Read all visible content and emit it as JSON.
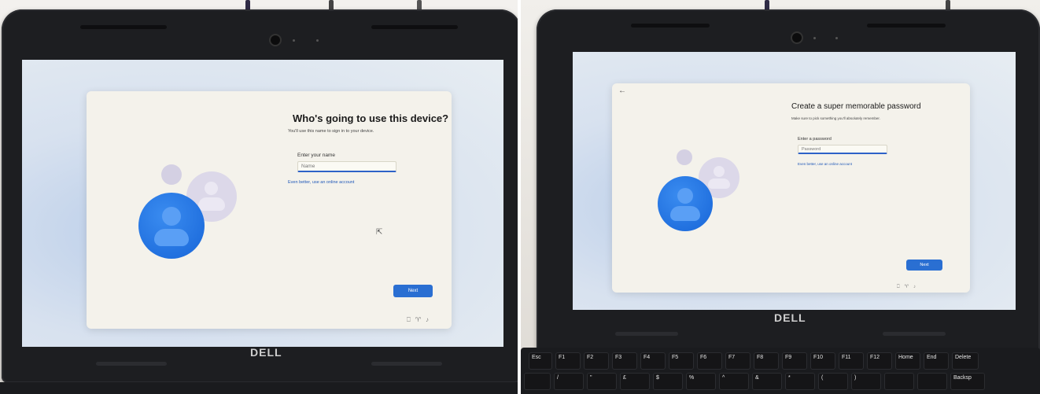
{
  "left_photo": {
    "laptop_brand": "DELL",
    "dialog": {
      "title": "Who's going to use this device?",
      "subtitle": "You'll use this name to sign in to your device.",
      "field_label": "Enter your name",
      "field_placeholder": "Name",
      "link": "Even better, use an online account",
      "next_button": "Next"
    },
    "icons": [
      "user-avatar-icon",
      "pointer-cursor-icon",
      "accessibility-icon",
      "network-icon",
      "volume-icon"
    ]
  },
  "right_photo": {
    "laptop_brand": "DELL",
    "dialog": {
      "title": "Create a super memorable password",
      "subtitle": "Make sure to pick something you'll absolutely remember.",
      "field_label": "Enter a password",
      "field_placeholder": "Password",
      "link": "Even better, use an online account",
      "next_button": "Next",
      "back_glyph": "←"
    },
    "keyboard": {
      "row1": [
        "Esc",
        "F1",
        "F2",
        "F3",
        "F4",
        "F5",
        "F6",
        "F7",
        "F8",
        "F9",
        "F10",
        "F11",
        "F12",
        "Home",
        "End",
        "Delete"
      ],
      "row2": [
        "",
        "/",
        "\"",
        "£",
        "$",
        "%",
        "^",
        "&",
        "*",
        "(",
        ")",
        "",
        "",
        "Backsp"
      ]
    },
    "icons": [
      "user-avatar-icon",
      "back-arrow-icon",
      "accessibility-icon",
      "network-icon",
      "volume-icon"
    ]
  },
  "colors": {
    "accent": "#2a6fd2",
    "avatar_blue": "#1d6ee0",
    "bezel": "#1d1e21"
  }
}
